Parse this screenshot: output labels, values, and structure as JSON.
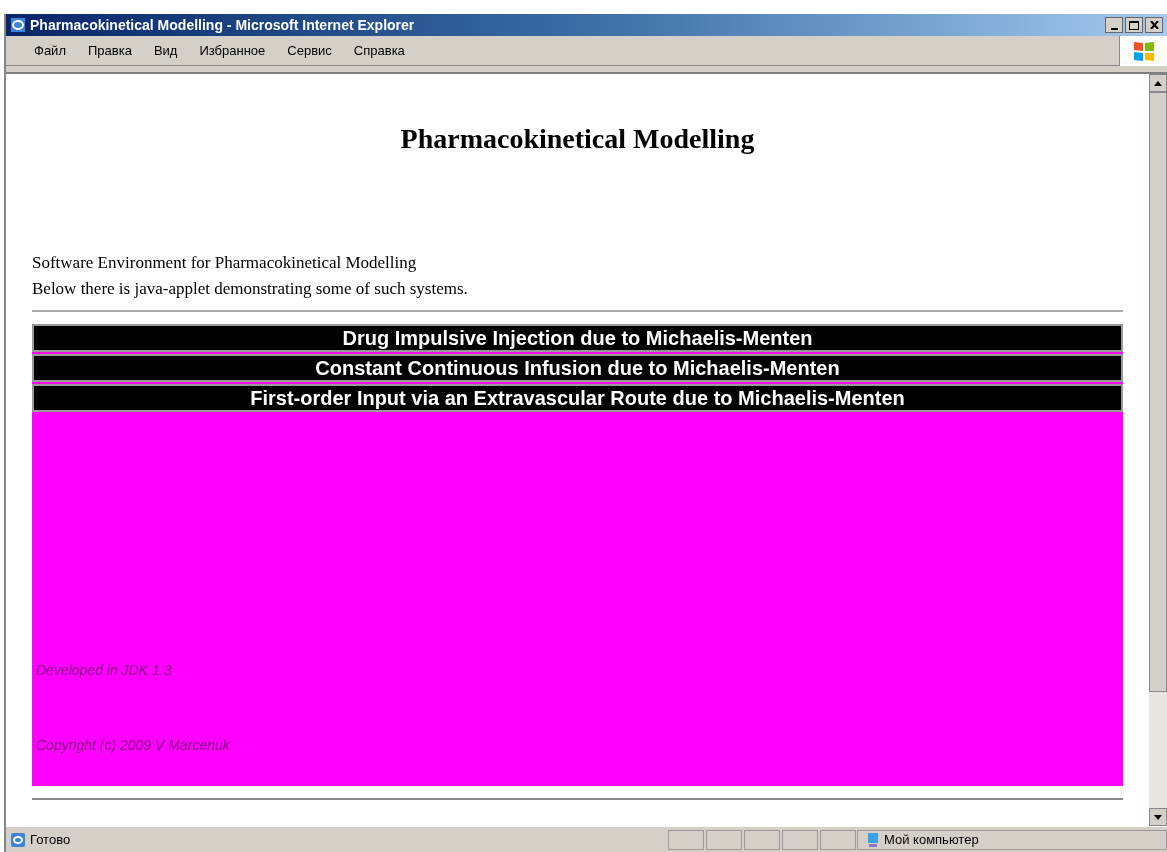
{
  "window": {
    "title": "Pharmacokinetical Modelling - Microsoft Internet Explorer"
  },
  "menu": [
    "Файл",
    "Правка",
    "Вид",
    "Избранное",
    "Сервис",
    "Справка"
  ],
  "page": {
    "heading": "Pharmacokinetical Modelling",
    "intro": [
      "Software Environment for Pharmacokinetical Modelling",
      "Below there is java-applet demonstrating some of such systems."
    ],
    "applet": {
      "buttons": [
        "Drug Impulsive Injection due to Michaelis-Menten",
        "Constant Continuous Infusion due to Michaelis-Menten",
        "First-order Input via an Extravascular Route due to Michaelis-Menten"
      ],
      "notes": [
        "Developed in JDK 1.3",
        "Copyright (c) 2009 V Marcenuk"
      ]
    }
  },
  "status_bar": {
    "status": "Готово",
    "zone": "Мой компьютер"
  }
}
